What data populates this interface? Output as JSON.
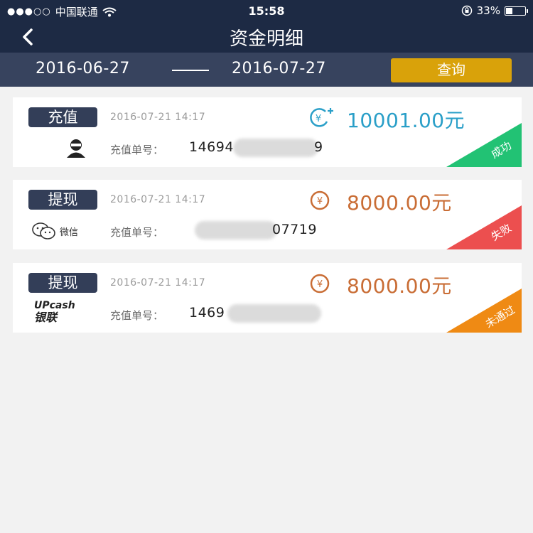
{
  "status_bar": {
    "signal_dots": "●●●○○",
    "carrier": "中国联通",
    "time": "15:58",
    "battery": "33%",
    "icons": [
      "signal-dots-icon",
      "wifi-icon",
      "orientation-lock-icon",
      "battery-icon"
    ]
  },
  "nav": {
    "title": "资金明细",
    "back_icon": "chevron-left-icon"
  },
  "date_filter": {
    "start_date": "2016-06-27",
    "end_date": "2016-07-27",
    "query_label": "查询"
  },
  "records": [
    {
      "type": "充值",
      "timestamp": "2016-07-21 14:17",
      "amount": "10001.00元",
      "amount_color": "#2a9fc8",
      "amount_icon": "yen-plus-icon",
      "method_icon": "ninja-avatar-icon",
      "order_label": "充值单号：",
      "order_prefix": "14694",
      "order_suffix": "9",
      "status": "成功",
      "status_color": "#22c274"
    },
    {
      "type": "提现",
      "timestamp": "2016-07-21 14:17",
      "amount": "8000.00元",
      "amount_color": "#c96d35",
      "amount_icon": "yen-circle-icon",
      "method_icon": "wechat-icon",
      "method_text": "微信",
      "order_label": "充值单号：",
      "order_prefix": "",
      "order_suffix": "07719",
      "status": "失败",
      "status_color": "#ec4f4f"
    },
    {
      "type": "提现",
      "timestamp": "2016-07-21 14:17",
      "amount": "8000.00元",
      "amount_color": "#c96d35",
      "amount_icon": "yen-circle-icon",
      "method_icon": "upcash-unionpay-icon",
      "method_text_top": "UPcash",
      "method_text_bottom": "银联",
      "order_label": "充值单号：",
      "order_prefix": "1469",
      "order_suffix": "",
      "status": "未通过",
      "status_color": "#ef8a14"
    }
  ]
}
